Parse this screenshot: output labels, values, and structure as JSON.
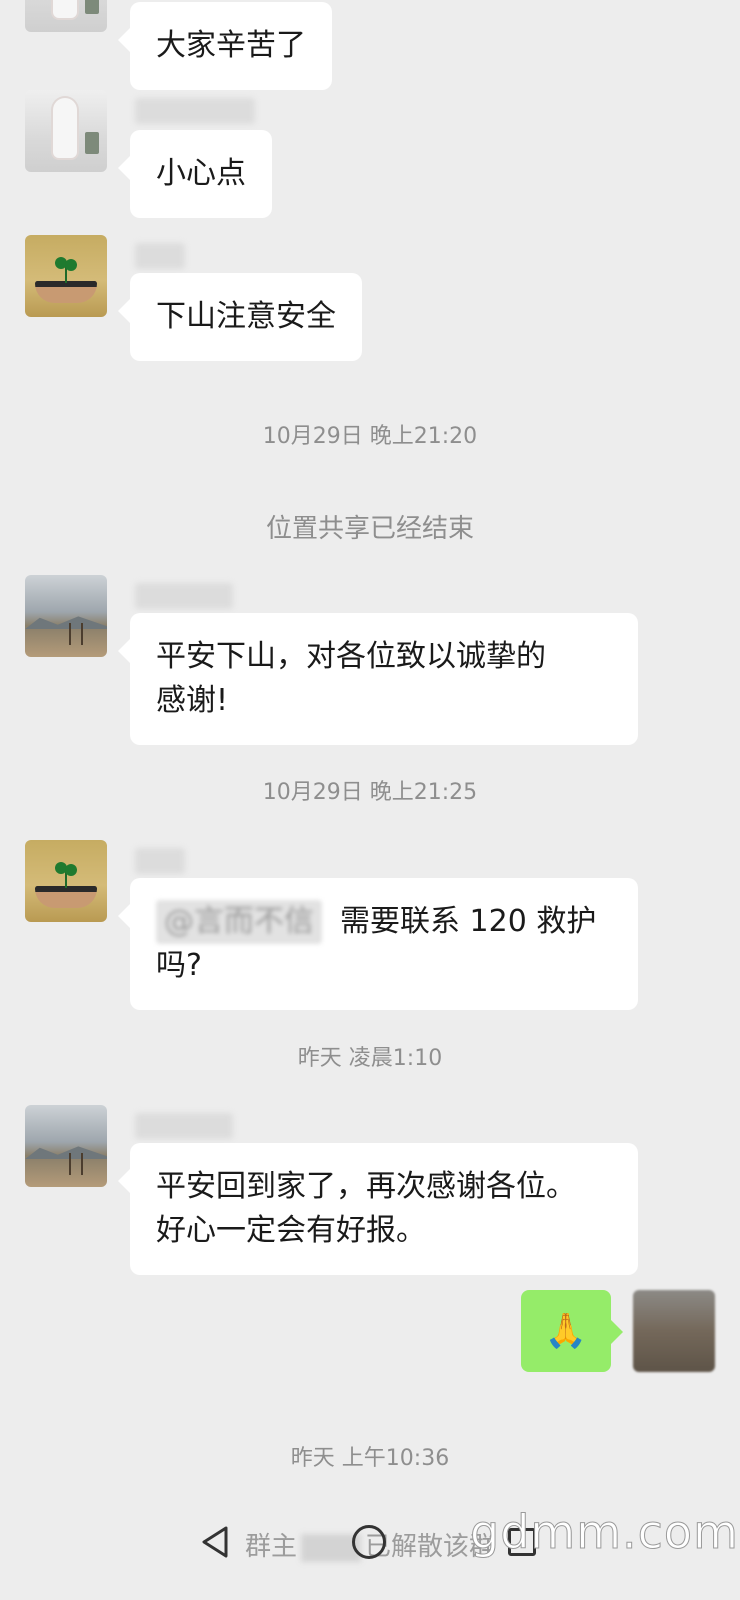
{
  "messages": [
    {
      "text": "大家辛苦了"
    },
    {
      "text": "小心点"
    },
    {
      "text": "下山注意安全"
    },
    {
      "text_line1": "平安下山，对各位致以诚挚的",
      "text_line2": "感谢!"
    },
    {
      "mention": "@言而不信",
      "text_line1": "需要联系 120 救护",
      "text_line2": "吗?"
    },
    {
      "text_line1": "平安回到家了，再次感谢各位。",
      "text_line2": "好心一定会有好报。"
    }
  ],
  "timestamps": [
    "10月29日 晚上21:20",
    "10月29日 晚上21:25",
    "昨天 凌晨1:10",
    "昨天 上午10:36"
  ],
  "system": {
    "location_share_ended": "位置共享已经结束",
    "group_dissolved_prefix": "群主",
    "group_dissolved_suffix": "已解散该群"
  },
  "outgoing": {
    "emoji": "🙏"
  },
  "watermark": "gdmm.com",
  "colors": {
    "background": "#ededed",
    "incoming_bubble": "#ffffff",
    "outgoing_bubble": "#95ec69",
    "meta_text": "#8e8e8e"
  },
  "icons": [
    "back-icon",
    "home-icon",
    "recent-apps-icon"
  ]
}
